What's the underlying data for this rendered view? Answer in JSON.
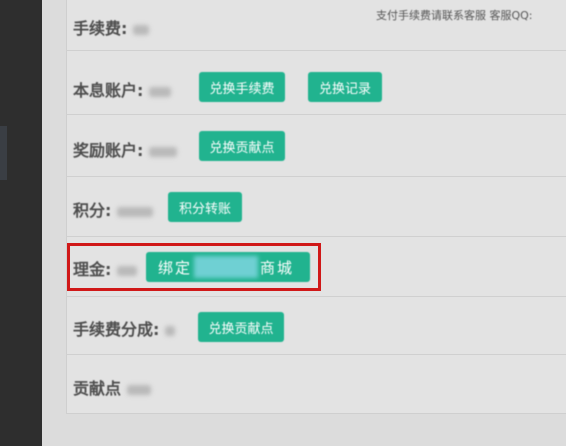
{
  "note": "支付手续费请联系客服 客服QQ:",
  "rows": [
    {
      "label": "手续费:",
      "buttons": []
    },
    {
      "label": "本息账户:",
      "buttons": [
        "兑换手续费",
        "兑换记录"
      ]
    },
    {
      "label": "奖励账户:",
      "buttons": [
        "兑换贡献点"
      ]
    },
    {
      "label": "积分:",
      "buttons": [
        "积分转账"
      ]
    },
    {
      "label": "理金:",
      "bind_prefix": "绑定",
      "bind_suffix": "商城"
    },
    {
      "label": "手续费分成:",
      "buttons": [
        "兑换贡献点"
      ]
    },
    {
      "label": "贡献点",
      "buttons": []
    }
  ]
}
